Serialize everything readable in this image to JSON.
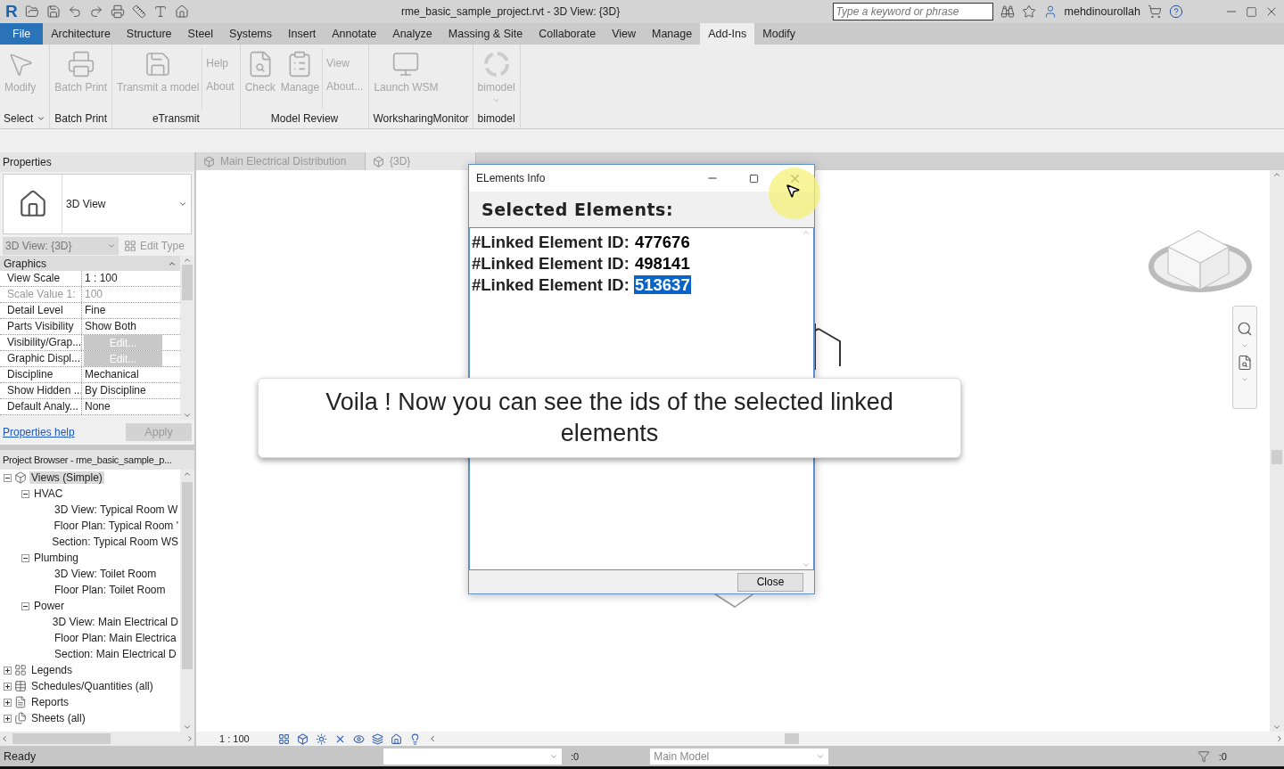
{
  "title_bar": {
    "logo": "R",
    "title": "rme_basic_sample_project.rvt - 3D View: {3D}",
    "search_placeholder": "Type a keyword or phrase",
    "user": "mehdinourollah"
  },
  "menu_tabs": [
    {
      "label": "File",
      "kind": "file",
      "selected": false
    },
    {
      "label": "Architecture",
      "kind": "tab",
      "selected": false
    },
    {
      "label": "Structure",
      "kind": "tab",
      "selected": false
    },
    {
      "label": "Steel",
      "kind": "tab",
      "selected": false
    },
    {
      "label": "Systems",
      "kind": "tab",
      "selected": false
    },
    {
      "label": "Insert",
      "kind": "tab",
      "selected": false
    },
    {
      "label": "Annotate",
      "kind": "tab",
      "selected": false
    },
    {
      "label": "Analyze",
      "kind": "tab",
      "selected": false
    },
    {
      "label": "Massing & Site",
      "kind": "tab",
      "selected": false
    },
    {
      "label": "Collaborate",
      "kind": "tab",
      "selected": false
    },
    {
      "label": "View",
      "kind": "tab",
      "selected": false
    },
    {
      "label": "Manage",
      "kind": "tab",
      "selected": false
    },
    {
      "label": "Add-Ins",
      "kind": "tab",
      "selected": true
    },
    {
      "label": "Modify",
      "kind": "tab",
      "selected": false
    }
  ],
  "ribbon_panels": [
    {
      "title": "Select",
      "buttons": [
        {
          "kind": "large",
          "label": "Modify",
          "disabled": true
        }
      ]
    },
    {
      "title": "Batch Print",
      "buttons": [
        {
          "kind": "large",
          "label": "Batch Print",
          "disabled": true
        }
      ]
    },
    {
      "title": "eTransmit",
      "buttons": [
        {
          "kind": "large",
          "label": "Transmit a model",
          "disabled": true
        },
        {
          "kind": "stack",
          "labels": [
            "Help",
            "About"
          ],
          "disabled": true
        }
      ]
    },
    {
      "title": "Model Review",
      "buttons": [
        {
          "kind": "large",
          "label": "Check",
          "disabled": true
        },
        {
          "kind": "large",
          "label": "Manage",
          "disabled": true
        },
        {
          "kind": "stack",
          "labels": [
            "View",
            "About..."
          ],
          "disabled": true
        }
      ]
    },
    {
      "title": "WorksharingMonitor",
      "buttons": [
        {
          "kind": "large",
          "label": "Launch WSM",
          "disabled": true
        }
      ]
    },
    {
      "title": "bimodel",
      "buttons": [
        {
          "kind": "large",
          "label": "bimodel",
          "disabled": true
        }
      ]
    }
  ],
  "properties": {
    "title": "Properties",
    "type_name": "3D View",
    "view_selector": "3D View: {3D}",
    "edit_type": "Edit Type",
    "group": "Graphics",
    "rows": [
      {
        "name": "View Scale",
        "value": "1 : 100",
        "kind": "text",
        "disabled": false
      },
      {
        "name": "Scale Value    1:",
        "value": "100",
        "kind": "text",
        "disabled": true
      },
      {
        "name": "Detail Level",
        "value": "Fine",
        "kind": "text",
        "disabled": false
      },
      {
        "name": "Parts Visibility",
        "value": "Show Both",
        "kind": "text",
        "disabled": false
      },
      {
        "name": "Visibility/Grap...",
        "value": "Edit...",
        "kind": "button",
        "disabled": false
      },
      {
        "name": "Graphic Displ...",
        "value": "Edit...",
        "kind": "button",
        "disabled": false
      },
      {
        "name": "Discipline",
        "value": "Mechanical",
        "kind": "text",
        "disabled": false
      },
      {
        "name": "Show Hidden ...",
        "value": "By Discipline",
        "kind": "text",
        "disabled": false
      },
      {
        "name": "Default Analy...",
        "value": "None",
        "kind": "text",
        "disabled": false
      }
    ],
    "help_link": "Properties help",
    "apply": "Apply"
  },
  "project_browser": {
    "title": "Project Browser - rme_basic_sample_p...",
    "tree": [
      {
        "label": "Views (Simple)",
        "kind": "views",
        "expanded": true,
        "selected": true,
        "children": [
          {
            "label": "HVAC",
            "expanded": true,
            "selected": false,
            "children": [
              {
                "label": "3D View: Typical Room W",
                "selected": false
              },
              {
                "label": "Floor Plan: Typical Room '",
                "selected": false
              },
              {
                "label": "Section: Typical Room WS",
                "selected": false
              }
            ]
          },
          {
            "label": "Plumbing",
            "expanded": true,
            "selected": false,
            "children": [
              {
                "label": "3D View: Toilet Room",
                "selected": false
              },
              {
                "label": "Floor Plan: Toilet Room",
                "selected": false
              }
            ]
          },
          {
            "label": "Power",
            "expanded": true,
            "selected": false,
            "children": [
              {
                "label": "3D View: Main Electrical D",
                "selected": false
              },
              {
                "label": "Floor Plan: Main Electrica",
                "selected": false
              },
              {
                "label": "Section: Main Electrical D",
                "selected": false
              }
            ]
          }
        ]
      },
      {
        "label": "Legends",
        "kind": "legends",
        "expanded": false,
        "selected": false
      },
      {
        "label": "Schedules/Quantities (all)",
        "kind": "schedules",
        "expanded": false,
        "selected": false
      },
      {
        "label": "Reports",
        "kind": "reports",
        "expanded": false,
        "selected": false
      },
      {
        "label": "Sheets (all)",
        "kind": "sheets",
        "expanded": false,
        "selected": false
      }
    ]
  },
  "view_tabs": [
    {
      "label": "Main Electrical Distribution",
      "selected": false
    },
    {
      "label": "{3D}",
      "selected": true
    }
  ],
  "dialog": {
    "title": "ELements Info",
    "heading": "Selected Elements:",
    "lines": [
      {
        "label": "#Linked Element ID:",
        "id": "477676",
        "selected": false
      },
      {
        "label": "#Linked Element ID:",
        "id": "498141",
        "selected": false
      },
      {
        "label": "#Linked Element ID:",
        "id": "513637",
        "selected": true
      }
    ],
    "close": "Close"
  },
  "callout": "Voila ! Now you can see the ids of the selected linked elements",
  "view_bar": {
    "scale": "1 : 100"
  },
  "status_bar": {
    "status": "Ready",
    "selection_count": ":0",
    "workset": "Main Model",
    "filter_count": ":0"
  }
}
